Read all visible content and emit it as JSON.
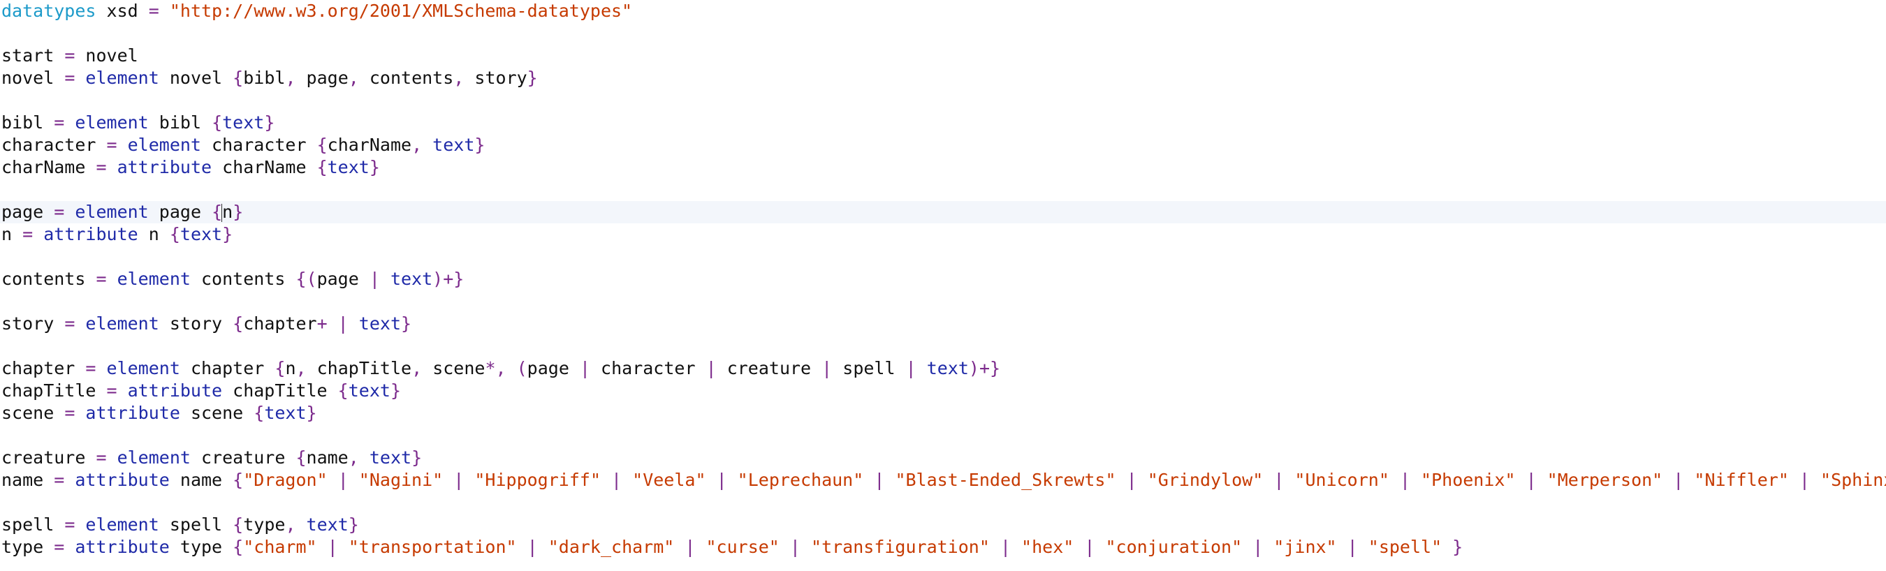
{
  "editor": {
    "current_line": 9,
    "lines": [
      [
        [
          "top",
          "datatypes"
        ],
        [
          "pl",
          " xsd "
        ],
        [
          "op",
          "="
        ],
        [
          "str",
          " \"http://www.w3.org/2001/XMLSchema-datatypes\""
        ]
      ],
      [],
      [
        [
          "pl",
          "start "
        ],
        [
          "op",
          "="
        ],
        [
          "pl",
          " novel"
        ]
      ],
      [
        [
          "pl",
          "novel "
        ],
        [
          "op",
          "="
        ],
        [
          "kw",
          " element"
        ],
        [
          "pl",
          " novel "
        ],
        [
          "op",
          "{"
        ],
        [
          "pl",
          "bibl"
        ],
        [
          "op",
          ","
        ],
        [
          "pl",
          " page"
        ],
        [
          "op",
          ","
        ],
        [
          "pl",
          " contents"
        ],
        [
          "op",
          ","
        ],
        [
          "pl",
          " story"
        ],
        [
          "op",
          "}"
        ]
      ],
      [],
      [
        [
          "pl",
          "bibl "
        ],
        [
          "op",
          "="
        ],
        [
          "kw",
          " element"
        ],
        [
          "pl",
          " bibl "
        ],
        [
          "op",
          "{"
        ],
        [
          "kw",
          "text"
        ],
        [
          "op",
          "}"
        ]
      ],
      [
        [
          "pl",
          "character "
        ],
        [
          "op",
          "="
        ],
        [
          "kw",
          " element"
        ],
        [
          "pl",
          " character "
        ],
        [
          "op",
          "{"
        ],
        [
          "pl",
          "charName"
        ],
        [
          "op",
          ","
        ],
        [
          "kw",
          " text"
        ],
        [
          "op",
          "}"
        ]
      ],
      [
        [
          "pl",
          "charName "
        ],
        [
          "op",
          "="
        ],
        [
          "kw",
          " attribute"
        ],
        [
          "pl",
          " charName "
        ],
        [
          "op",
          "{"
        ],
        [
          "kw",
          "text"
        ],
        [
          "op",
          "}"
        ]
      ],
      [],
      [
        [
          "pl",
          "page "
        ],
        [
          "op",
          "="
        ],
        [
          "kw",
          " element"
        ],
        [
          "pl",
          " page "
        ],
        [
          "op",
          "{"
        ],
        [
          "caret",
          ""
        ],
        [
          "pl",
          "n"
        ],
        [
          "op",
          "}"
        ]
      ],
      [
        [
          "pl",
          "n "
        ],
        [
          "op",
          "="
        ],
        [
          "kw",
          " attribute"
        ],
        [
          "pl",
          " n "
        ],
        [
          "op",
          "{"
        ],
        [
          "kw",
          "text"
        ],
        [
          "op",
          "}"
        ]
      ],
      [],
      [
        [
          "pl",
          "contents "
        ],
        [
          "op",
          "="
        ],
        [
          "kw",
          " element"
        ],
        [
          "pl",
          " contents "
        ],
        [
          "op",
          "{("
        ],
        [
          "pl",
          "page "
        ],
        [
          "op",
          "|"
        ],
        [
          "kw",
          " text"
        ],
        [
          "op",
          ")+}"
        ]
      ],
      [],
      [
        [
          "pl",
          "story "
        ],
        [
          "op",
          "="
        ],
        [
          "kw",
          " element"
        ],
        [
          "pl",
          " story "
        ],
        [
          "op",
          "{"
        ],
        [
          "pl",
          "chapter"
        ],
        [
          "op",
          "+ |"
        ],
        [
          "kw",
          " text"
        ],
        [
          "op",
          "}"
        ]
      ],
      [],
      [
        [
          "pl",
          "chapter "
        ],
        [
          "op",
          "="
        ],
        [
          "kw",
          " element"
        ],
        [
          "pl",
          " chapter "
        ],
        [
          "op",
          "{"
        ],
        [
          "pl",
          "n"
        ],
        [
          "op",
          ","
        ],
        [
          "pl",
          " chapTitle"
        ],
        [
          "op",
          ","
        ],
        [
          "pl",
          " scene"
        ],
        [
          "op",
          "*, ("
        ],
        [
          "pl",
          "page "
        ],
        [
          "op",
          "|"
        ],
        [
          "pl",
          " character "
        ],
        [
          "op",
          "|"
        ],
        [
          "pl",
          " creature "
        ],
        [
          "op",
          "|"
        ],
        [
          "pl",
          " spell "
        ],
        [
          "op",
          "|"
        ],
        [
          "kw",
          " text"
        ],
        [
          "op",
          ")+}"
        ]
      ],
      [
        [
          "pl",
          "chapTitle "
        ],
        [
          "op",
          "="
        ],
        [
          "kw",
          " attribute"
        ],
        [
          "pl",
          " chapTitle "
        ],
        [
          "op",
          "{"
        ],
        [
          "kw",
          "text"
        ],
        [
          "op",
          "}"
        ]
      ],
      [
        [
          "pl",
          "scene "
        ],
        [
          "op",
          "="
        ],
        [
          "kw",
          " attribute"
        ],
        [
          "pl",
          " scene "
        ],
        [
          "op",
          "{"
        ],
        [
          "kw",
          "text"
        ],
        [
          "op",
          "}"
        ]
      ],
      [],
      [
        [
          "pl",
          "creature "
        ],
        [
          "op",
          "="
        ],
        [
          "kw",
          " element"
        ],
        [
          "pl",
          " creature "
        ],
        [
          "op",
          "{"
        ],
        [
          "pl",
          "name"
        ],
        [
          "op",
          ","
        ],
        [
          "kw",
          " text"
        ],
        [
          "op",
          "}"
        ]
      ],
      [
        [
          "pl",
          "name "
        ],
        [
          "op",
          "="
        ],
        [
          "kw",
          " attribute"
        ],
        [
          "pl",
          " name "
        ],
        [
          "op",
          "{"
        ],
        [
          "str",
          "\"Dragon\""
        ],
        [
          "op",
          " | "
        ],
        [
          "str",
          "\"Nagini\""
        ],
        [
          "op",
          " | "
        ],
        [
          "str",
          "\"Hippogriff\""
        ],
        [
          "op",
          " | "
        ],
        [
          "str",
          "\"Veela\""
        ],
        [
          "op",
          " | "
        ],
        [
          "str",
          "\"Leprechaun\""
        ],
        [
          "op",
          " | "
        ],
        [
          "str",
          "\"Blast-Ended_Skrewts\""
        ],
        [
          "op",
          " | "
        ],
        [
          "str",
          "\"Grindylow\""
        ],
        [
          "op",
          " | "
        ],
        [
          "str",
          "\"Unicorn\""
        ],
        [
          "op",
          " | "
        ],
        [
          "str",
          "\"Phoenix\""
        ],
        [
          "op",
          " | "
        ],
        [
          "str",
          "\"Merperson\""
        ],
        [
          "op",
          " | "
        ],
        [
          "str",
          "\"Niffler\""
        ],
        [
          "op",
          " | "
        ],
        [
          "str",
          "\"Sphinx\""
        ],
        [
          "op",
          " }"
        ]
      ],
      [],
      [
        [
          "pl",
          "spell "
        ],
        [
          "op",
          "="
        ],
        [
          "kw",
          " element"
        ],
        [
          "pl",
          " spell "
        ],
        [
          "op",
          "{"
        ],
        [
          "pl",
          "type"
        ],
        [
          "op",
          ","
        ],
        [
          "kw",
          " text"
        ],
        [
          "op",
          "}"
        ]
      ],
      [
        [
          "pl",
          "type "
        ],
        [
          "op",
          "="
        ],
        [
          "kw",
          " attribute"
        ],
        [
          "pl",
          " type "
        ],
        [
          "op",
          "{"
        ],
        [
          "str",
          "\"charm\""
        ],
        [
          "op",
          " | "
        ],
        [
          "str",
          "\"transportation\""
        ],
        [
          "op",
          " | "
        ],
        [
          "str",
          "\"dark_charm\""
        ],
        [
          "op",
          " | "
        ],
        [
          "str",
          "\"curse\""
        ],
        [
          "op",
          " | "
        ],
        [
          "str",
          "\"transfiguration\""
        ],
        [
          "op",
          " | "
        ],
        [
          "str",
          "\"hex\""
        ],
        [
          "op",
          " | "
        ],
        [
          "str",
          "\"conjuration\""
        ],
        [
          "op",
          " | "
        ],
        [
          "str",
          "\"jinx\""
        ],
        [
          "op",
          " | "
        ],
        [
          "str",
          "\"spell\""
        ],
        [
          "op",
          " }"
        ]
      ]
    ]
  }
}
